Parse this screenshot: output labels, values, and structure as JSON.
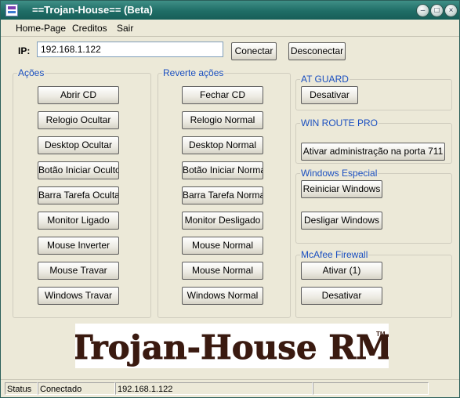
{
  "window": {
    "title": "==Trojan-House== (Beta)"
  },
  "menu": {
    "home": "Home-Page",
    "credits": "Creditos",
    "exit": "Sair"
  },
  "ip": {
    "label": "IP:",
    "value": "192.168.1.122"
  },
  "buttons": {
    "connect": "Conectar",
    "disconnect": "Desconectar"
  },
  "acoes": {
    "title": "Ações",
    "items": [
      "Abrir CD",
      "Relogio Ocultar",
      "Desktop Ocultar",
      "Botão Iniciar Oculto",
      "Barra Tarefa Ocultar",
      "Monitor Ligado",
      "Mouse Inverter",
      "Mouse Travar",
      "Windows Travar"
    ]
  },
  "reverte": {
    "title": "Reverte ações",
    "items": [
      "Fechar CD",
      "Relogio Normal",
      "Desktop Normal",
      "Botão Iniciar Normal",
      "Barra Tarefa Normal",
      "Monitor Desligado",
      "Mouse Normal",
      "Mouse Normal",
      "Windows Normal"
    ]
  },
  "atguard": {
    "title": "AT GUARD",
    "button": "Desativar"
  },
  "winroute": {
    "title": "WIN ROUTE PRO",
    "button": "Ativar administração na porta 711"
  },
  "winesp": {
    "title": "Windows Especial",
    "restart": "Reiniciar Windows",
    "shutdown": "Desligar Windows"
  },
  "mcafee": {
    "title": "McAfee Firewall",
    "activate": "Ativar (1)",
    "deactivate": "Desativar"
  },
  "banner": {
    "text": "Trojan-House RM",
    "tm": "TM"
  },
  "status": {
    "label": "Status",
    "state": "Conectado",
    "ip": "192.168.1.122",
    "extra": ""
  }
}
